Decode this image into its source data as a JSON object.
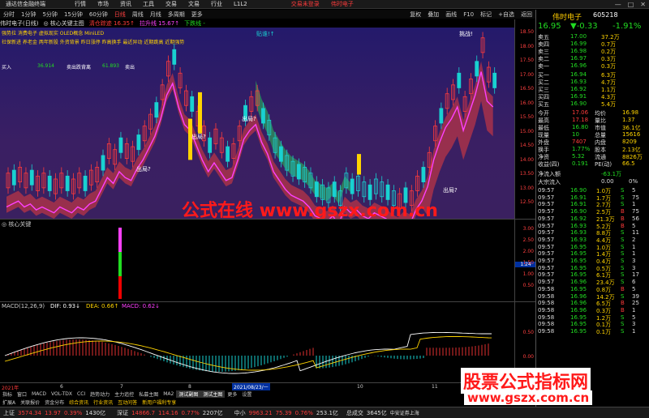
{
  "titlebar": {
    "app_name": "通达信金融终端",
    "menus": [
      "行情",
      "市场",
      "资讯",
      "工具",
      "交易",
      "文易",
      "行业",
      "L1L2"
    ],
    "login_notice": "交易未登录",
    "stock_name": "伟时电子",
    "window_buttons": [
      "—",
      "□",
      "✕"
    ]
  },
  "toolbar": {
    "periods": [
      "分时",
      "1分钟",
      "5分钟",
      "15分钟",
      "60分钟",
      "日线",
      "周线",
      "月线",
      "多周期",
      "更多"
    ],
    "active_period": "日线",
    "right_buttons": [
      "复权",
      "叠加",
      "画线",
      "F10",
      "标记",
      "+自选",
      "返回"
    ]
  },
  "chart_header": {
    "stock": "伟时电子(日线)",
    "indicator": "◎ 核心关键主图",
    "lows_label": "清仓踪迹 16.35↑",
    "trend_label": "拉升线 15.67↑",
    "down_label": "下跌线 -"
  },
  "main_chart": {
    "tags_row1": "强势拉 消费电子 虚拟现实 OLED概念 MiniLED",
    "tags_row2": "社保新进 养老金 两年新股 外资背景 昨日涨停 昨高换手 最近异动 近期跳高 近期强势",
    "buy_label": "买入",
    "buy_value": "36.914",
    "sell_label1": "卖出跌背离",
    "sell_value": "61.893",
    "sell_label2": "卖出",
    "annotations": [
      "贴谁!↑",
      "挑战!",
      "出局?",
      "出局?",
      "出局?",
      "出局?",
      "出局?"
    ],
    "y_ticks": [
      "18.50",
      "18.00",
      "17.50",
      "17.00",
      "16.50",
      "16.00",
      "15.50",
      "15.00",
      "14.50",
      "14.00",
      "13.50",
      "13.00",
      "12.50"
    ],
    "watermark": "公式在线 www.gszx.com.cn"
  },
  "sub_chart1": {
    "title": "◎ 核心关键",
    "y_ticks": [
      "3.00",
      "2.50",
      "2.00",
      "1.50",
      "1.00",
      "0.50"
    ],
    "current_value": "1.24"
  },
  "sub_chart2": {
    "title": "MACD(12,26,9)",
    "dif": "DIF: 0.93↓",
    "dea": "DEA: 0.66↑",
    "macd": "MACD: 0.62↓",
    "y_ticks": [
      "0.50",
      "0.00"
    ]
  },
  "date_row": {
    "start": "2021年",
    "date_mark": "2021/08/23/一",
    "labels": [
      "6",
      "7",
      "8",
      "9",
      "10",
      "11"
    ]
  },
  "tabs": {
    "row1": [
      "指标",
      "窗口",
      "MACD",
      "VOL-TDX",
      "CCI",
      "趋势动力",
      "主力追控",
      "私募主图",
      "MA2",
      "测试副图",
      "测试主图",
      "更多",
      "设置"
    ],
    "row2": [
      "扩展A",
      "关联报价",
      "资金分布",
      "综合资讯",
      "行业资讯",
      "互动问答",
      "新用户福利专享"
    ]
  },
  "statusbar": {
    "items": [
      {
        "name": "上证",
        "value": "3574.34",
        "chg": "13.97",
        "pct": "0.39%",
        "amt": "1430亿"
      },
      {
        "name": "深证",
        "value": "14866.7",
        "chg": "114.16",
        "pct": "0.77%",
        "amt": "2207亿"
      },
      {
        "name": "中小",
        "value": "9963.21",
        "chg": "75.39",
        "pct": "0.76%",
        "amt": "253.1亿"
      }
    ],
    "total_label": "总成交",
    "total_value": "3645亿",
    "broker": "中安证券上海",
    "watermark": "股票公式指标网",
    "watermark_url": "www.gszx.com.cn"
  },
  "quote_panel": {
    "name": "伟时电子",
    "code": "605218",
    "price": "16.95",
    "change": "▼-0.33",
    "change_pct": "-1.91%",
    "asks": [
      {
        "label": "卖五",
        "price": "17.00",
        "vol": "37.2万"
      },
      {
        "label": "卖四",
        "price": "16.99",
        "vol": "0.7万"
      },
      {
        "label": "卖三",
        "price": "16.98",
        "vol": "0.2万"
      },
      {
        "label": "卖二",
        "price": "16.97",
        "vol": "0.3万"
      },
      {
        "label": "卖一",
        "price": "16.96",
        "vol": "0.3万"
      }
    ],
    "bids": [
      {
        "label": "买一",
        "price": "16.94",
        "vol": "6.3万"
      },
      {
        "label": "买二",
        "price": "16.93",
        "vol": "4.7万"
      },
      {
        "label": "买三",
        "price": "16.92",
        "vol": "1.1万"
      },
      {
        "label": "买四",
        "price": "16.91",
        "vol": "4.3万"
      },
      {
        "label": "买五",
        "price": "16.90",
        "vol": "5.4万"
      }
    ],
    "stats": [
      {
        "l1": "今开",
        "v1": "17.06",
        "l2": "均价",
        "v2": "16.98"
      },
      {
        "l1": "最高",
        "v1": "17.18",
        "l2": "量比",
        "v2": "1.37"
      },
      {
        "l1": "最低",
        "v1": "16.80",
        "l2": "市值",
        "v2": "36.1亿"
      },
      {
        "l1": "现量",
        "v1": "10",
        "l2": "总量",
        "v2": "15616"
      },
      {
        "l1": "外盘",
        "v1": "7407",
        "l2": "内盘",
        "v2": "8209"
      },
      {
        "l1": "换手",
        "v1": "1.77%",
        "l2": "股本",
        "v2": "2.13亿"
      },
      {
        "l1": "净资",
        "v1": "5.32",
        "l2": "流通",
        "v2": "8826万"
      },
      {
        "l1": "收益(四)",
        "v1": "0.191",
        "l2": "PE(动)",
        "v2": "66.5"
      }
    ],
    "net_inflow_label": "净流入额",
    "net_inflow_value": "-63.1万",
    "big_inflow_label": "大宗流入",
    "big_inflow_value": "0.00",
    "big_inflow_pct": "0%",
    "ticks": [
      {
        "time": "09:57",
        "price": "16.90",
        "vol": "1.0万",
        "dir": "S",
        "n": "5"
      },
      {
        "time": "09:57",
        "price": "16.91",
        "vol": "1.7万",
        "dir": "S",
        "n": "75"
      },
      {
        "time": "09:57",
        "price": "16.91",
        "vol": "2.7万",
        "dir": "S",
        "n": "1"
      },
      {
        "time": "09:57",
        "price": "16.90",
        "vol": "2.5万",
        "dir": "B",
        "n": "75"
      },
      {
        "time": "09:57",
        "price": "16.92",
        "vol": "21.3万",
        "dir": "B",
        "n": "56"
      },
      {
        "time": "09:57",
        "price": "16.93",
        "vol": "5.2万",
        "dir": "B",
        "n": "5"
      },
      {
        "time": "09:57",
        "price": "16.93",
        "vol": "8.8万",
        "dir": "S",
        "n": "11"
      },
      {
        "time": "09:57",
        "price": "16.93",
        "vol": "4.4万",
        "dir": "S",
        "n": "2"
      },
      {
        "time": "09:57",
        "price": "16.95",
        "vol": "1.0万",
        "dir": "S",
        "n": "1"
      },
      {
        "time": "09:57",
        "price": "16.95",
        "vol": "1.4万",
        "dir": "S",
        "n": "1"
      },
      {
        "time": "09:57",
        "price": "16.95",
        "vol": "0.4万",
        "dir": "S",
        "n": "3"
      },
      {
        "time": "09:57",
        "price": "16.95",
        "vol": "0.5万",
        "dir": "S",
        "n": "3"
      },
      {
        "time": "09:57",
        "price": "16.95",
        "vol": "6.1万",
        "dir": "S",
        "n": "17"
      },
      {
        "time": "09:57",
        "price": "16.96",
        "vol": "23.4万",
        "dir": "S",
        "n": "6"
      },
      {
        "time": "09:58",
        "price": "16.95",
        "vol": "0.8万",
        "dir": "B",
        "n": "5"
      },
      {
        "time": "09:58",
        "price": "16.96",
        "vol": "14.2万",
        "dir": "S",
        "n": "39"
      },
      {
        "time": "09:58",
        "price": "16.96",
        "vol": "6.5万",
        "dir": "B",
        "n": "25"
      },
      {
        "time": "09:58",
        "price": "16.96",
        "vol": "0.3万",
        "dir": "B",
        "n": "1"
      },
      {
        "time": "09:58",
        "price": "16.95",
        "vol": "1.2万",
        "dir": "S",
        "n": "5"
      },
      {
        "time": "09:58",
        "price": "16.95",
        "vol": "0.1万",
        "dir": "S",
        "n": "3"
      },
      {
        "time": "09:58",
        "price": "16.95",
        "vol": "0.1万",
        "dir": "S",
        "n": "1"
      }
    ]
  },
  "colors": {
    "up": "#ff3b3b",
    "down": "#19d1d1",
    "green": "#22dd22",
    "yellow": "#ffd400",
    "magenta": "#ff40ff"
  }
}
